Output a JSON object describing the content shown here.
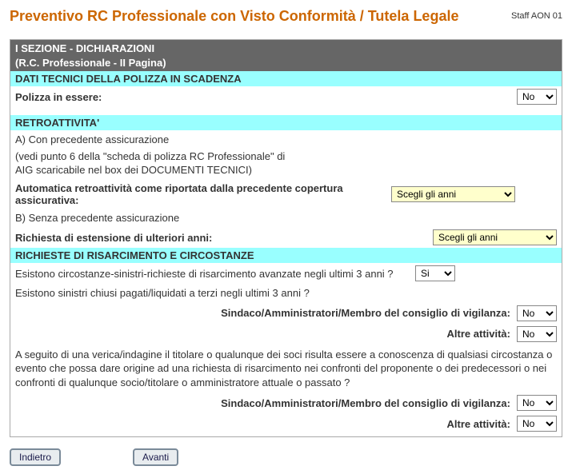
{
  "header": {
    "title": "Preventivo RC Professionale con Visto Conformità / Tutela Legale",
    "staff": "Staff AON 01"
  },
  "section": {
    "title_line1": "I SEZIONE - DICHIARAZIONI",
    "title_line2": "(R.C. Professionale - II Pagina)"
  },
  "dati_tecnici": {
    "header": "DATI TECNICI DELLA POLIZZA IN SCADENZA",
    "polizza_label": "Polizza in essere:",
    "polizza_value": "No"
  },
  "retro": {
    "header": "RETROATTIVITA'",
    "a_label": "A) Con precedente assicurazione",
    "a_note1": "(vedi punto 6 della \"scheda di polizza RC Professionale\" di",
    "a_note2": "AIG scaricabile nel box dei DOCUMENTI TECNICI)",
    "auto_label": "Automatica retroattività come riportata dalla precedente copertura assicurativa:",
    "auto_value": "Scegli gli anni",
    "b_label": "B) Senza precedente assicurazione",
    "ext_label": "Richiesta di estensione di ulteriori anni:",
    "ext_value": "Scegli gli anni"
  },
  "risarcimento": {
    "header": "RICHIESTE DI RISARCIMENTO E CIRCOSTANZE",
    "q1_label": "Esistono circostanze-sinistri-richieste di risarcimento avanzate negli ultimi 3 anni ?",
    "q1_value": "Si",
    "q2_label": "Esistono sinistri chiusi pagati/liquidati a terzi negli ultimi 3 anni ?",
    "q2_sindaco_label": "Sindaco/Amministratori/Membro del consiglio di vigilanza:",
    "q2_sindaco_value": "No",
    "q2_altre_label": "Altre attività:",
    "q2_altre_value": "No",
    "q3_label": "A seguito di una verica/indagine il titolare o qualunque dei soci risulta essere a conoscenza di qualsiasi circostanza o evento che possa dare origine ad una richiesta di risarcimento nei confronti del proponente o dei predecessori o nei confronti di qualunque socio/titolare o amministratore attuale o passato ?",
    "q3_sindaco_label": "Sindaco/Amministratori/Membro del consiglio di vigilanza:",
    "q3_sindaco_value": "No",
    "q3_altre_label": "Altre attività:",
    "q3_altre_value": "No"
  },
  "buttons": {
    "back": "Indietro",
    "next": "Avanti"
  }
}
